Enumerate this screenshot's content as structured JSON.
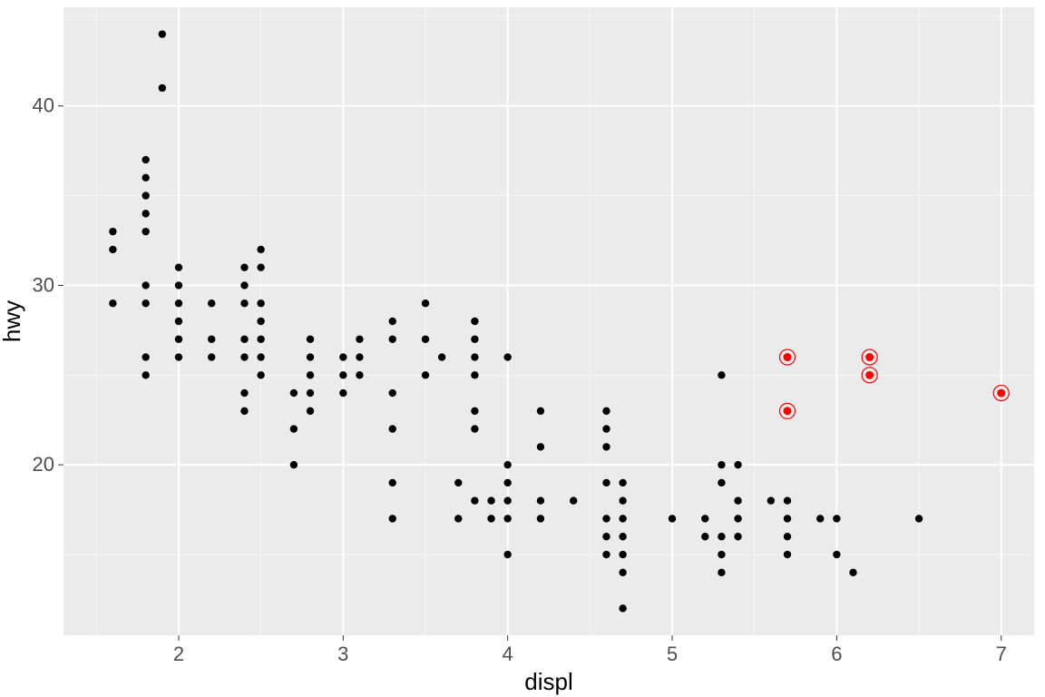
{
  "chart_data": {
    "type": "scatter",
    "xlabel": "displ",
    "ylabel": "hwy",
    "xlim": [
      1.3,
      7.2
    ],
    "ylim": [
      10.5,
      45.5
    ],
    "x_ticks": [
      2,
      3,
      4,
      5,
      6,
      7
    ],
    "y_ticks": [
      20,
      30,
      40
    ],
    "x_minor": [
      1.5,
      2.5,
      3.5,
      4.5,
      5.5,
      6.5
    ],
    "y_minor": [
      15,
      25,
      35,
      45
    ],
    "series": [
      {
        "name": "points",
        "color": "#000000",
        "points": [
          [
            1.6,
            33
          ],
          [
            1.6,
            32
          ],
          [
            1.6,
            29
          ],
          [
            1.8,
            36
          ],
          [
            1.8,
            37
          ],
          [
            1.8,
            35
          ],
          [
            1.8,
            34
          ],
          [
            1.8,
            33
          ],
          [
            1.8,
            30
          ],
          [
            1.8,
            29
          ],
          [
            1.8,
            26
          ],
          [
            1.8,
            25
          ],
          [
            1.9,
            44
          ],
          [
            1.9,
            41
          ],
          [
            2.0,
            31
          ],
          [
            2.0,
            30
          ],
          [
            2.0,
            29
          ],
          [
            2.0,
            28
          ],
          [
            2.0,
            27
          ],
          [
            2.0,
            26
          ],
          [
            2.2,
            29
          ],
          [
            2.2,
            27
          ],
          [
            2.2,
            26
          ],
          [
            2.4,
            31
          ],
          [
            2.4,
            30
          ],
          [
            2.4,
            29
          ],
          [
            2.4,
            27
          ],
          [
            2.4,
            26
          ],
          [
            2.4,
            24
          ],
          [
            2.4,
            23
          ],
          [
            2.5,
            32
          ],
          [
            2.5,
            31
          ],
          [
            2.5,
            29
          ],
          [
            2.5,
            28
          ],
          [
            2.5,
            27
          ],
          [
            2.5,
            26
          ],
          [
            2.5,
            25
          ],
          [
            2.7,
            24
          ],
          [
            2.7,
            22
          ],
          [
            2.7,
            20
          ],
          [
            2.8,
            27
          ],
          [
            2.8,
            26
          ],
          [
            2.8,
            25
          ],
          [
            2.8,
            24
          ],
          [
            2.8,
            23
          ],
          [
            3.0,
            26
          ],
          [
            3.0,
            25
          ],
          [
            3.0,
            24
          ],
          [
            3.1,
            27
          ],
          [
            3.1,
            26
          ],
          [
            3.1,
            25
          ],
          [
            3.3,
            28
          ],
          [
            3.3,
            27
          ],
          [
            3.3,
            24
          ],
          [
            3.3,
            22
          ],
          [
            3.3,
            19
          ],
          [
            3.3,
            17
          ],
          [
            3.5,
            29
          ],
          [
            3.5,
            27
          ],
          [
            3.5,
            25
          ],
          [
            3.6,
            26
          ],
          [
            3.7,
            19
          ],
          [
            3.7,
            17
          ],
          [
            3.8,
            28
          ],
          [
            3.8,
            27
          ],
          [
            3.8,
            26
          ],
          [
            3.8,
            25
          ],
          [
            3.8,
            23
          ],
          [
            3.8,
            22
          ],
          [
            3.8,
            18
          ],
          [
            3.9,
            18
          ],
          [
            3.9,
            17
          ],
          [
            4.0,
            26
          ],
          [
            4.0,
            20
          ],
          [
            4.0,
            19
          ],
          [
            4.0,
            18
          ],
          [
            4.0,
            17
          ],
          [
            4.0,
            15
          ],
          [
            4.2,
            23
          ],
          [
            4.2,
            21
          ],
          [
            4.2,
            18
          ],
          [
            4.2,
            17
          ],
          [
            4.4,
            18
          ],
          [
            4.6,
            23
          ],
          [
            4.6,
            22
          ],
          [
            4.6,
            21
          ],
          [
            4.6,
            19
          ],
          [
            4.6,
            17
          ],
          [
            4.6,
            16
          ],
          [
            4.6,
            15
          ],
          [
            4.7,
            19
          ],
          [
            4.7,
            18
          ],
          [
            4.7,
            17
          ],
          [
            4.7,
            16
          ],
          [
            4.7,
            15
          ],
          [
            4.7,
            14
          ],
          [
            4.7,
            12
          ],
          [
            5.0,
            17
          ],
          [
            5.2,
            17
          ],
          [
            5.2,
            16
          ],
          [
            5.3,
            20
          ],
          [
            5.3,
            25
          ],
          [
            5.3,
            19
          ],
          [
            5.3,
            16
          ],
          [
            5.3,
            15
          ],
          [
            5.3,
            14
          ],
          [
            5.4,
            20
          ],
          [
            5.4,
            18
          ],
          [
            5.4,
            17
          ],
          [
            5.4,
            16
          ],
          [
            5.6,
            18
          ],
          [
            5.7,
            18
          ],
          [
            5.7,
            17
          ],
          [
            5.7,
            16
          ],
          [
            5.7,
            15
          ],
          [
            5.9,
            17
          ],
          [
            6.0,
            17
          ],
          [
            6.0,
            15
          ],
          [
            6.1,
            14
          ],
          [
            6.5,
            17
          ]
        ]
      },
      {
        "name": "highlighted",
        "color": "#ff0000",
        "points": [
          [
            5.7,
            26
          ],
          [
            5.7,
            23
          ],
          [
            6.2,
            26
          ],
          [
            6.2,
            25
          ],
          [
            7.0,
            24
          ]
        ]
      }
    ]
  },
  "layout": {
    "plot_left": 70,
    "plot_top": 8,
    "plot_right": 1140,
    "plot_bottom": 700,
    "xlabel_x": 605,
    "xlabel_y": 760,
    "ylabel_x": 22,
    "ylabel_y": 354,
    "point_radius_normal": 4.2,
    "point_radius_hi_inner": 4.5,
    "point_radius_hi_outer": 8.5
  }
}
